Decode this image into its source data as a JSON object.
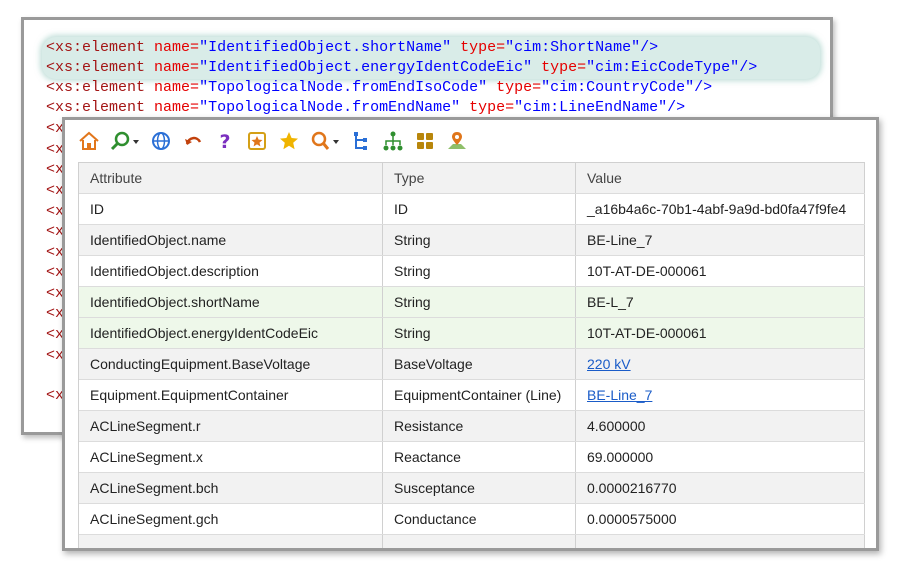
{
  "xml": {
    "lines": [
      {
        "tag": "<xs:element",
        "attr1": "name=",
        "val1": "\"IdentifiedObject.shortName\"",
        "attr2": "type=",
        "val2": "\"cim:ShortName\"",
        "end": "/>"
      },
      {
        "tag": "<xs:element",
        "attr1": "name=",
        "val1": "\"IdentifiedObject.energyIdentCodeEic\"",
        "attr2": "type=",
        "val2": "\"cim:EicCodeType\"",
        "end": "/>"
      },
      {
        "tag": "<xs:element",
        "attr1": "name=",
        "val1": "\"TopologicalNode.fromEndIsoCode\"",
        "attr2": "type=",
        "val2": "\"cim:CountryCode\"",
        "end": "/>"
      },
      {
        "tag": "<xs:element",
        "attr1": "name=",
        "val1": "\"TopologicalNode.fromEndName\"",
        "attr2": "type=",
        "val2": "\"cim:LineEndName\"",
        "end": "/>"
      }
    ],
    "fragment": "<x"
  },
  "toolbar": {
    "icons": [
      "home-icon",
      "search-dropdown-icon",
      "globe-icon",
      "undo-icon",
      "help-icon",
      "favorite-box-icon",
      "star-icon",
      "find-dropdown-icon",
      "tree-icon",
      "hierarchy-icon",
      "grid-icon",
      "map-pin-icon"
    ]
  },
  "table": {
    "headers": {
      "attribute": "Attribute",
      "type": "Type",
      "value": "Value"
    },
    "rows": [
      {
        "attribute": "ID",
        "type": "ID",
        "value": "_a16b4a6c-70b1-4abf-9a9d-bd0fa47f9fe4"
      },
      {
        "attribute": "IdentifiedObject.name",
        "type": "String",
        "value": "BE-Line_7"
      },
      {
        "attribute": "IdentifiedObject.description",
        "type": "String",
        "value": "10T-AT-DE-000061"
      },
      {
        "attribute": "IdentifiedObject.shortName",
        "type": "String",
        "value": "BE-L_7"
      },
      {
        "attribute": "IdentifiedObject.energyIdentCodeEic",
        "type": "String",
        "value": "10T-AT-DE-000061"
      },
      {
        "attribute": "ConductingEquipment.BaseVoltage",
        "type": "BaseVoltage",
        "value": "220 kV"
      },
      {
        "attribute": "Equipment.EquipmentContainer",
        "type": "EquipmentContainer (Line)",
        "value": "BE-Line_7"
      },
      {
        "attribute": "ACLineSegment.r",
        "type": "Resistance",
        "value": "4.600000"
      },
      {
        "attribute": "ACLineSegment.x",
        "type": "Reactance",
        "value": "69.000000"
      },
      {
        "attribute": "ACLineSegment.bch",
        "type": "Susceptance",
        "value": "0.0000216770"
      },
      {
        "attribute": "ACLineSegment.gch",
        "type": "Conductance",
        "value": "0.0000575000"
      }
    ]
  },
  "colors": {
    "highlight_row": "#eef8ea",
    "link": "#1a5cc8",
    "xml_tag": "#a31515",
    "xml_attr": "#e50000",
    "xml_value": "#0000ff"
  }
}
